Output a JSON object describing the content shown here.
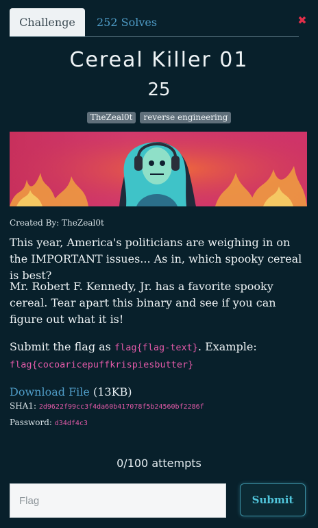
{
  "tabs": {
    "challenge": "Challenge",
    "solves": "252 Solves"
  },
  "close_icon": "close-icon",
  "challenge": {
    "title": "Cereal Killer 01",
    "points": "25",
    "tags": [
      "TheZeal0t",
      "reverse engineering"
    ],
    "created_by": "Created By: TheZeal0t",
    "paragraph1": "This year, America's politicians are weighing in on the IMPORTANT issues... As in, which spooky cereal is best?",
    "paragraph2": "Mr. Robert F. Kennedy, Jr. has a favorite spooky cereal. Tear apart this binary and see if you can figure out what it is!",
    "submit_prefix": "Submit the flag as ",
    "flag_format": "flag{flag-text}",
    "example_label": ". Example:",
    "example_flag": "flag{cocoaricepuffkrispiesbutter}"
  },
  "file": {
    "link": "Download File",
    "size": " (13KB)",
    "sha1_label": "SHA1: ",
    "sha1": "2d9622f99cc3f4da60b417078f5b24560bf2286f",
    "password_label": "Password: ",
    "password": "d34df4c3"
  },
  "attempts": "0/100 attempts",
  "form": {
    "placeholder": "Flag",
    "submit": "Submit"
  },
  "colors": {
    "background": "#08202b",
    "accent": "#4f9cc7",
    "code": "#e25aa8",
    "close": "#e22f4a"
  }
}
